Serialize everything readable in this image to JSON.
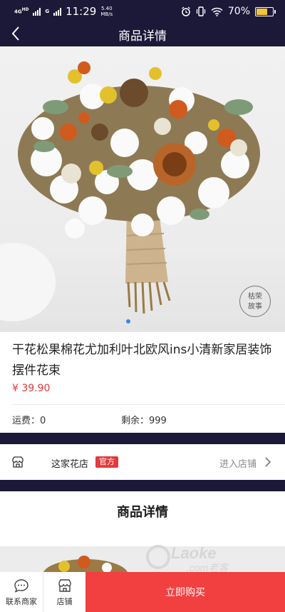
{
  "status_bar": {
    "network": "4G",
    "network_sub": "HD",
    "network2": "G",
    "time": "11:29",
    "speed_value": "5.40",
    "speed_unit": "MB/s",
    "battery": "70%",
    "battery_level": 0.7
  },
  "nav": {
    "title": "商品详情"
  },
  "product": {
    "name": "干花松果棉花尤加利叶北欧风ins小清新家居装饰摆件花束",
    "price": "¥ 39.90",
    "shipping": "运费：0",
    "stock": "剩余：999",
    "image_index": 1
  },
  "store": {
    "name": "这家花店",
    "badge": "官方",
    "enter_label": "进入店铺"
  },
  "details": {
    "title": "商品详情"
  },
  "watermark": {
    "text": "Laoke",
    "sub": ".com老客"
  },
  "seal": {
    "text": "枯荣故事"
  },
  "bottom_bar": {
    "contact_label": "联系商家",
    "store_label": "店铺",
    "buy_label": "立即购买"
  },
  "colors": {
    "header_bg": "#1c1838",
    "price": "#e4393c",
    "buy_button": "#f23f3f",
    "official_badge": "#e23b3b",
    "pager_dot": "#3a86e8"
  },
  "icons": [
    "back-icon",
    "alarm-icon",
    "vibrate-icon",
    "wifi-icon",
    "battery-icon",
    "store-icon",
    "chevron-right-icon",
    "chat-icon",
    "shop-icon"
  ]
}
